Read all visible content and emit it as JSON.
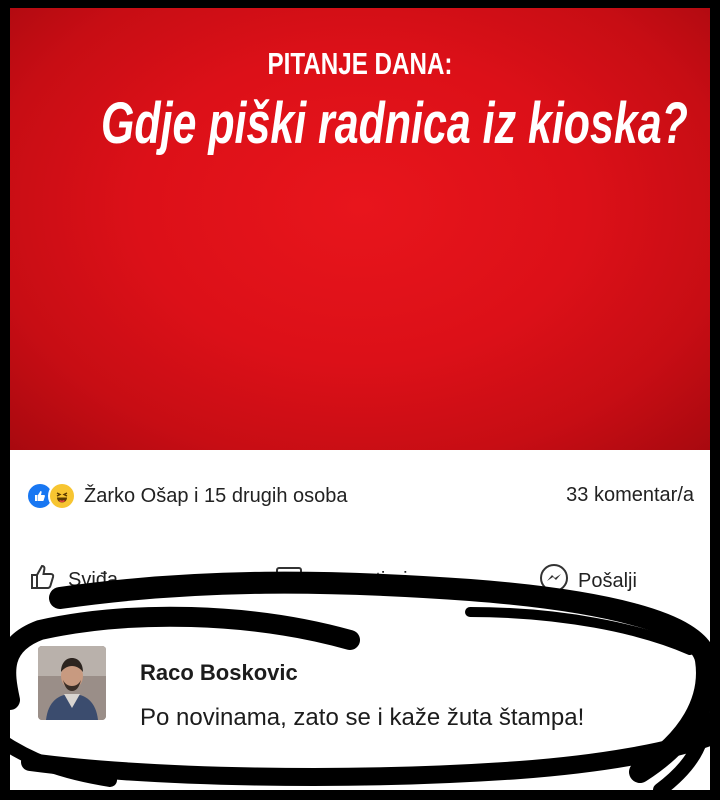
{
  "post": {
    "kicker": "PITANJE DANA:",
    "headline": "Gdje piški radnica iz kioska?"
  },
  "reactions": {
    "summary": "Žarko Ošap i 15 drugih osoba",
    "comments_count": "33 komentar/a",
    "icons": [
      "like-icon",
      "haha-icon"
    ]
  },
  "actions": {
    "like_label": "Sviđa",
    "comment_label": "Komentiraj",
    "send_label": "Pošalji"
  },
  "comment": {
    "author": "Raco Boskovic",
    "text": "Po novinama, zato se i kaže žuta štampa!"
  },
  "colors": {
    "banner_red": "#dc1018",
    "facebook_blue": "#1877f2",
    "haha_yellow": "#f7c531"
  }
}
